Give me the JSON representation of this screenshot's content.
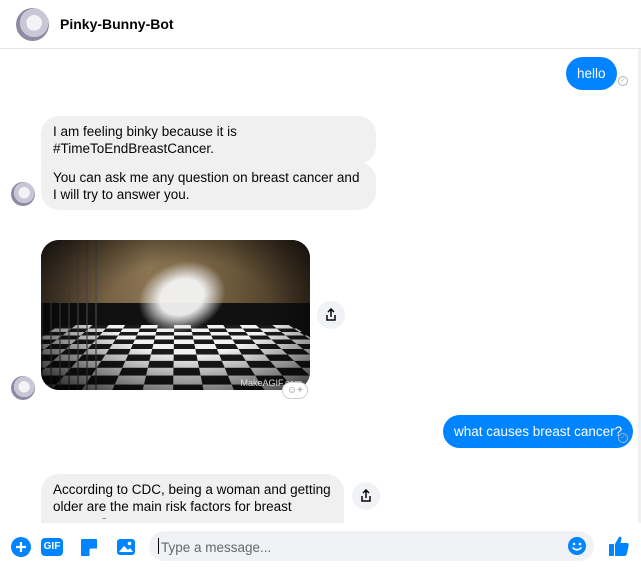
{
  "header": {
    "title": "Pinky-Bunny-Bot"
  },
  "messages": {
    "m1": "hello",
    "m2": "I am feeling binky because it is #TimeToEndBreastCancer.",
    "m3": "You can ask me any question on breast cancer and I will try to answer you.",
    "gif_watermark": "MakeAGIF.com",
    "m4": "what causes breast cancer?",
    "m5": "According to CDC, being a woman and getting older are the main risk factors for breast cancer. ?"
  },
  "composer": {
    "placeholder": "Type a message...",
    "gif_label": "GIF"
  },
  "colors": {
    "accent": "#0084ff",
    "incoming": "#f0f0f0"
  }
}
